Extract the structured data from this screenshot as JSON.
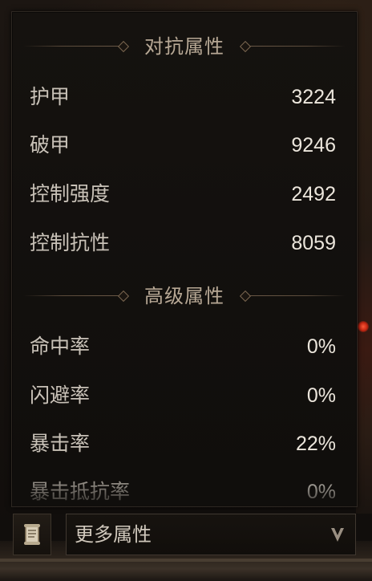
{
  "sections": [
    {
      "title": "对抗属性",
      "rows": [
        {
          "label": "护甲",
          "value": "3224"
        },
        {
          "label": "破甲",
          "value": "9246"
        },
        {
          "label": "控制强度",
          "value": "2492"
        },
        {
          "label": "控制抗性",
          "value": "8059"
        }
      ]
    },
    {
      "title": "高级属性",
      "rows": [
        {
          "label": "命中率",
          "value": "0%"
        },
        {
          "label": "闪避率",
          "value": "0%"
        },
        {
          "label": "暴击率",
          "value": "22%"
        },
        {
          "label": "暴击抵抗率",
          "value": "0%"
        }
      ]
    }
  ],
  "footer": {
    "dropdown_label": "更多属性",
    "scroll_icon": "scroll-icon",
    "dropdown_icon": "chevron-down-icon"
  },
  "colors": {
    "header_text": "#b7a895",
    "label_text": "#c9c2b8",
    "value_text": "#ece6dc",
    "panel_bg": "#100e0c"
  }
}
